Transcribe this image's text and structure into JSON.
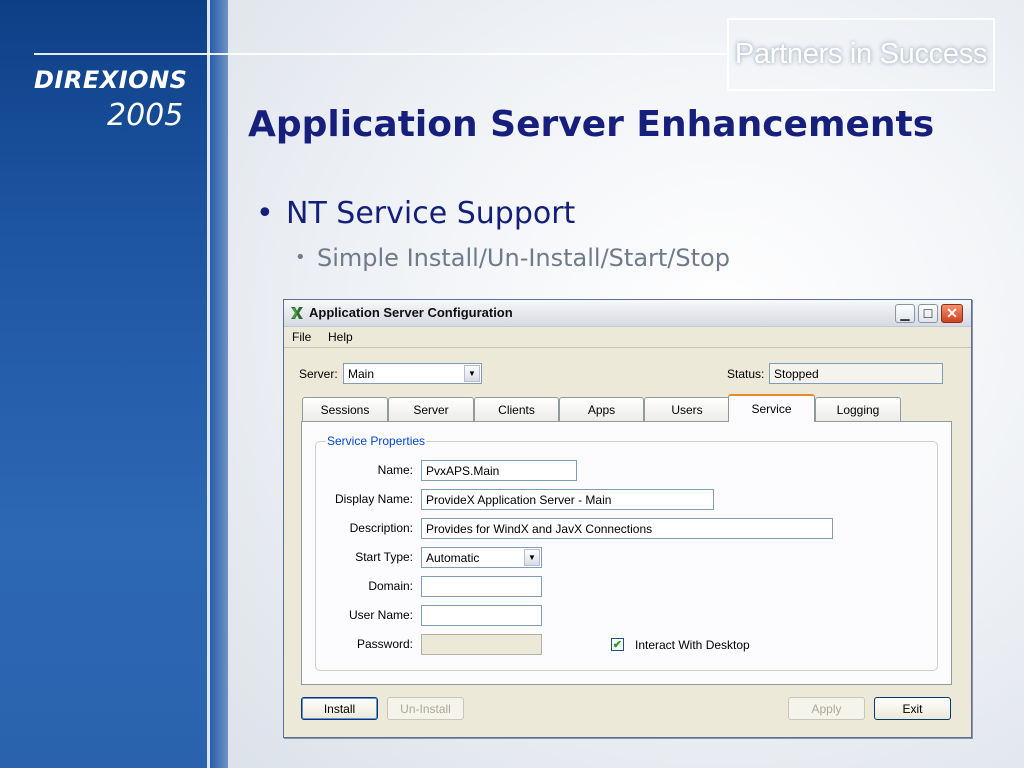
{
  "slide": {
    "logo_line1": "DIREXIONS",
    "logo_line2": "2005",
    "tagline": "Partners in Success",
    "title": "Application Server Enhancements",
    "bullet1": "NT Service Support",
    "bullet2": "Simple Install/Un-Install/Start/Stop"
  },
  "window": {
    "title": "Application Server Configuration",
    "menu": {
      "file_label": "File",
      "help_label": "Help"
    },
    "server_label": "Server:",
    "server_value": "Main",
    "status_label": "Status:",
    "status_value": "Stopped",
    "tabs": [
      "Sessions",
      "Server",
      "Clients",
      "Apps",
      "Users",
      "Service",
      "Logging"
    ],
    "active_tab": "Service",
    "group_title": "Service Properties",
    "fields": {
      "name_label": "Name:",
      "name_value": "PvxAPS.Main",
      "display_name_label": "Display Name:",
      "display_name_value": "ProvideX Application Server - Main",
      "description_label": "Description:",
      "description_value": "Provides for WindX and JavX Connections",
      "start_type_label": "Start Type:",
      "start_type_value": "Automatic",
      "domain_label": "Domain:",
      "domain_value": "",
      "user_name_label": "User Name:",
      "user_name_value": "",
      "password_label": "Password:",
      "password_value": ""
    },
    "interact_label": "Interact With Desktop",
    "interact_checked": true,
    "buttons": {
      "install": "Install",
      "uninstall": "Un-Install",
      "apply": "Apply",
      "exit": "Exit"
    },
    "icons": [
      "app-x-icon",
      "minimize-icon",
      "maximize-icon",
      "close-icon",
      "dropdown-arrow-icon",
      "checkmark-icon"
    ]
  }
}
